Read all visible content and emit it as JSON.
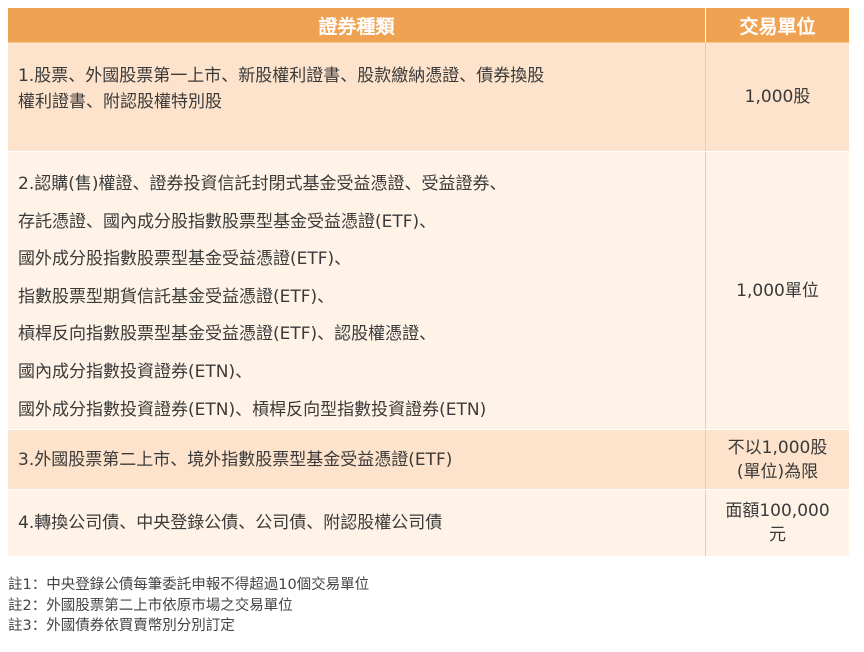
{
  "table": {
    "header": {
      "col1": "證券種類",
      "col2": "交易單位"
    },
    "rows": [
      {
        "lines": [
          "1.股票、外國股票第一上市、新股權利證書、股款繳納憑證、債券換股",
          "權利證書、附認股權特別股"
        ],
        "unit": "1,000股"
      },
      {
        "lines": [
          "2.認購(售)權證、證券投資信託封閉式基金受益憑證、受益證券、",
          "存託憑證、國內成分股指數股票型基金受益憑證(ETF)、",
          "國外成分股指數股票型基金受益憑證(ETF)、",
          "指數股票型期貨信託基金受益憑證(ETF)、",
          "槓桿反向指數股票型基金受益憑證(ETF)、認股權憑證、",
          "國內成分指數投資證券(ETN)、",
          "國外成分指數投資證券(ETN)、槓桿反向型指數投資證券(ETN)"
        ],
        "unit": "1,000單位"
      },
      {
        "lines": [
          "3.外國股票第二上市、境外指數股票型基金受益憑證(ETF)"
        ],
        "unit_lines": [
          "不以1,000股",
          "(單位)為限"
        ]
      },
      {
        "lines": [
          "4.轉換公司債、中央登錄公債、公司債、附認股權公司債"
        ],
        "unit_lines": [
          "面額100,000",
          "元"
        ]
      }
    ]
  },
  "notes": [
    "註1：中央登錄公債每筆委託申報不得超過10個交易單位",
    "註2：外國股票第二上市依原市場之交易單位",
    "註3：外國債券依買賣幣別分別訂定"
  ],
  "colors": {
    "header": "#f0a253",
    "row_dark": "#fde3cb",
    "row_light": "#fff3e8"
  }
}
